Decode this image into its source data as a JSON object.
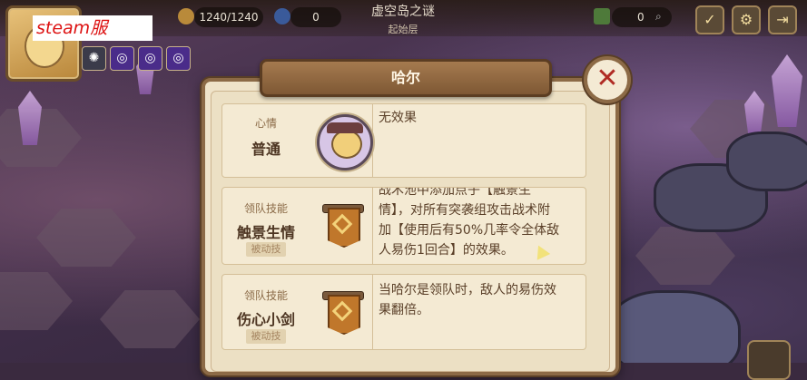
{
  "hud": {
    "overlay_label": "steam服",
    "energy": "1240/1240",
    "gems": "0",
    "map_title": "虚空岛之谜",
    "map_subtitle": "起始层",
    "chest_count": "0"
  },
  "dialog": {
    "title": "哈尔",
    "close_symbol": "✕",
    "mood": {
      "caption": "心情",
      "value": "普通",
      "effect": "无效果"
    },
    "skills": [
      {
        "caption": "领队技能",
        "name": "触景生情",
        "tag": "被动技",
        "desc_lines": [
          "战术池中添加点子【触景生",
          "情】，对所有突袭组攻击战术附",
          "加【使用后有50%几率令全体敌",
          "人易伤1回合】的效果。"
        ]
      },
      {
        "caption": "领队技能",
        "name": "伤心小剑",
        "tag": "被动技",
        "desc_lines": [
          "当哈尔是领队时，敌人的易伤效",
          "果翻倍。"
        ]
      }
    ]
  },
  "colors": {
    "panel": "#efe3c9",
    "frame": "#8c6a46",
    "accent_red": "#b02b24"
  }
}
